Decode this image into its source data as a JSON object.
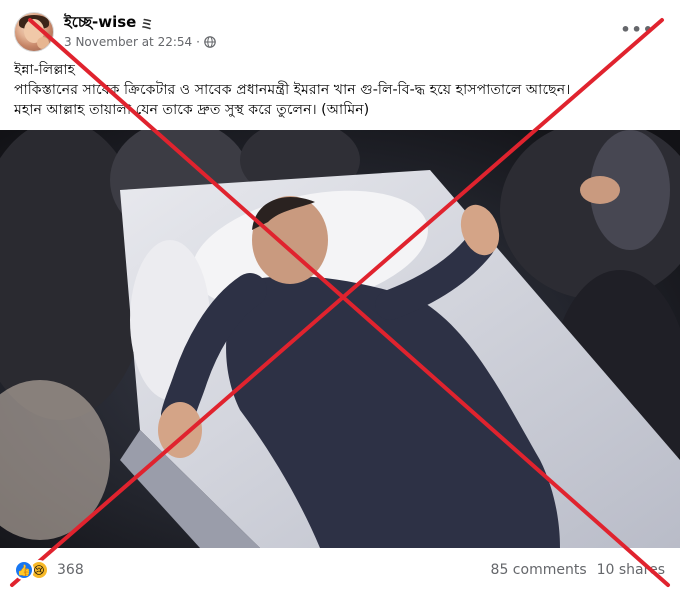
{
  "post": {
    "author": "ইচ্ছে-wise",
    "author_badge_icon": "triple-z-icon",
    "author_badge_glyph": "ミ",
    "timestamp": "3 November at 22:54",
    "separator": "·",
    "audience_icon": "globe-icon",
    "more_icon": "more-options-icon",
    "text_lines": [
      "ইন্না-লিল্লাহ",
      "পাকিস্তানের সাবেক ক্রিকেটার ও সাবেক প্রধানমন্ত্রী ইমরান খান গু-লি-বি-দ্ধ হয়ে হাসপাতালে আছেন।",
      "মহান আল্লাহ তায়ালা যেন তাকে দ্রুত সুস্থ করে তুলেন। (আমিন)"
    ],
    "photo_alt": "photo"
  },
  "footer": {
    "reaction_icons": [
      "like-icon",
      "sad-icon"
    ],
    "like_glyph": "👍",
    "sad_glyph": "😢",
    "reaction_count": "368",
    "comments": "85 comments",
    "shares": "10 shares"
  },
  "overlay": {
    "type": "red-cross",
    "color": "#e0232e"
  }
}
